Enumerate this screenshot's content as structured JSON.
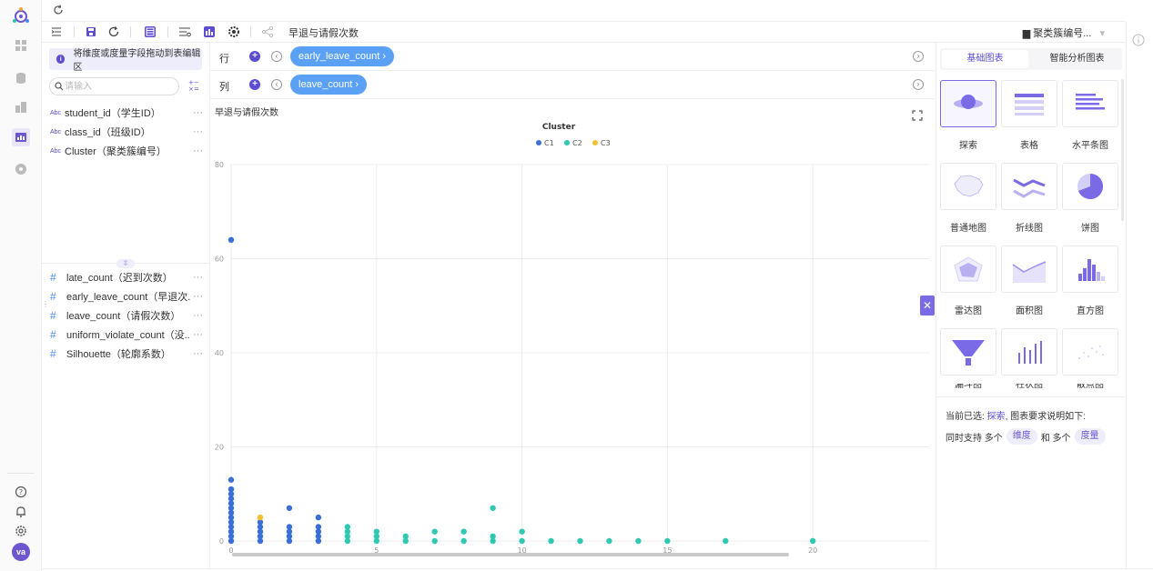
{
  "nav": {
    "items": [
      "logo-icon",
      "grid-icon",
      "database-icon",
      "cube-icon",
      "chart-icon",
      "dashboard-icon"
    ],
    "bottom": [
      "help-icon",
      "bell-icon",
      "settings-icon"
    ],
    "avatar": "va"
  },
  "toolbar": {
    "title": "早退与请假次数",
    "right_label": "聚类簇编号...",
    "right_caret": "▾"
  },
  "fields": {
    "hint": "将维度或度量字段拖动到表编辑区",
    "search_placeholder": "请输入",
    "dimensions": [
      {
        "type": "Abc",
        "label": "student_id（学生ID）"
      },
      {
        "type": "Abc",
        "label": "class_id（班级ID）"
      },
      {
        "type": "Abc",
        "label": "Cluster（聚类簇编号）"
      }
    ],
    "measures": [
      {
        "type": "#",
        "label": "late_count（迟到次数）"
      },
      {
        "type": "#",
        "label": "early_leave_count（早退次..."
      },
      {
        "type": "#",
        "label": "leave_count（请假次数）"
      },
      {
        "type": "#",
        "label": "uniform_violate_count（没..."
      },
      {
        "type": "#",
        "label": "Silhouette（轮廓系数）"
      }
    ],
    "more": "···",
    "handle": "⇳"
  },
  "shelves": {
    "row": {
      "name": "行",
      "pill": "early_leave_count ›"
    },
    "col": {
      "name": "列",
      "pill": "leave_count ›"
    }
  },
  "chart_title": "早退与请假次数",
  "chart_data": {
    "type": "scatter",
    "legend_title": "Cluster",
    "legend_position": "top-center",
    "xlim": [
      0,
      24
    ],
    "ylim": [
      0,
      80
    ],
    "x_ticks": [
      0,
      5,
      10,
      15,
      20
    ],
    "y_ticks": [
      0,
      20,
      40,
      60,
      80
    ],
    "grid": true,
    "series": [
      {
        "name": "C1",
        "color": "#3b6fd8",
        "points": [
          [
            0,
            64
          ],
          [
            0,
            13
          ],
          [
            0,
            11
          ],
          [
            0,
            10
          ],
          [
            0,
            9
          ],
          [
            0,
            8
          ],
          [
            0,
            7
          ],
          [
            0,
            6
          ],
          [
            0,
            5
          ],
          [
            0,
            4
          ],
          [
            0,
            3
          ],
          [
            0,
            2
          ],
          [
            0,
            1
          ],
          [
            0,
            0
          ],
          [
            1,
            4
          ],
          [
            1,
            3
          ],
          [
            1,
            2
          ],
          [
            1,
            1
          ],
          [
            1,
            0
          ],
          [
            2,
            7
          ],
          [
            2,
            3
          ],
          [
            2,
            2
          ],
          [
            2,
            1
          ],
          [
            2,
            0
          ],
          [
            3,
            5
          ],
          [
            3,
            3
          ],
          [
            3,
            2
          ],
          [
            3,
            1
          ],
          [
            3,
            0
          ]
        ]
      },
      {
        "name": "C2",
        "color": "#2ec9b0",
        "points": [
          [
            4,
            3
          ],
          [
            4,
            2
          ],
          [
            4,
            1
          ],
          [
            4,
            0
          ],
          [
            5,
            2
          ],
          [
            5,
            1
          ],
          [
            5,
            0
          ],
          [
            6,
            1
          ],
          [
            6,
            0
          ],
          [
            7,
            2
          ],
          [
            7,
            0
          ],
          [
            8,
            2
          ],
          [
            8,
            0
          ],
          [
            9,
            7
          ],
          [
            9,
            1
          ],
          [
            9,
            0
          ],
          [
            10,
            2
          ],
          [
            10,
            0
          ],
          [
            11,
            0
          ],
          [
            12,
            0
          ],
          [
            13,
            0
          ],
          [
            14,
            0
          ],
          [
            15,
            0
          ],
          [
            17,
            0
          ],
          [
            20,
            0
          ]
        ]
      },
      {
        "name": "C3",
        "color": "#f2c12e",
        "points": [
          [
            1,
            5
          ]
        ]
      }
    ]
  },
  "right": {
    "tabs": [
      "基础图表",
      "智能分析图表"
    ],
    "charts": [
      "探索",
      "表格",
      "水平条图",
      "普通地图",
      "折线图",
      "饼图",
      "雷达图",
      "面积图",
      "直方图",
      "漏斗图",
      "柱状图",
      "散点图"
    ],
    "desc_prefix": "当前已选:",
    "desc_selected": "探索",
    "desc_suffix": ", 图表要求说明如下:",
    "desc2_a": "同时支持 多个",
    "desc2_badge1": "维度",
    "desc2_b": "和 多个",
    "desc2_badge2": "度量"
  },
  "close_symbol": "✕"
}
